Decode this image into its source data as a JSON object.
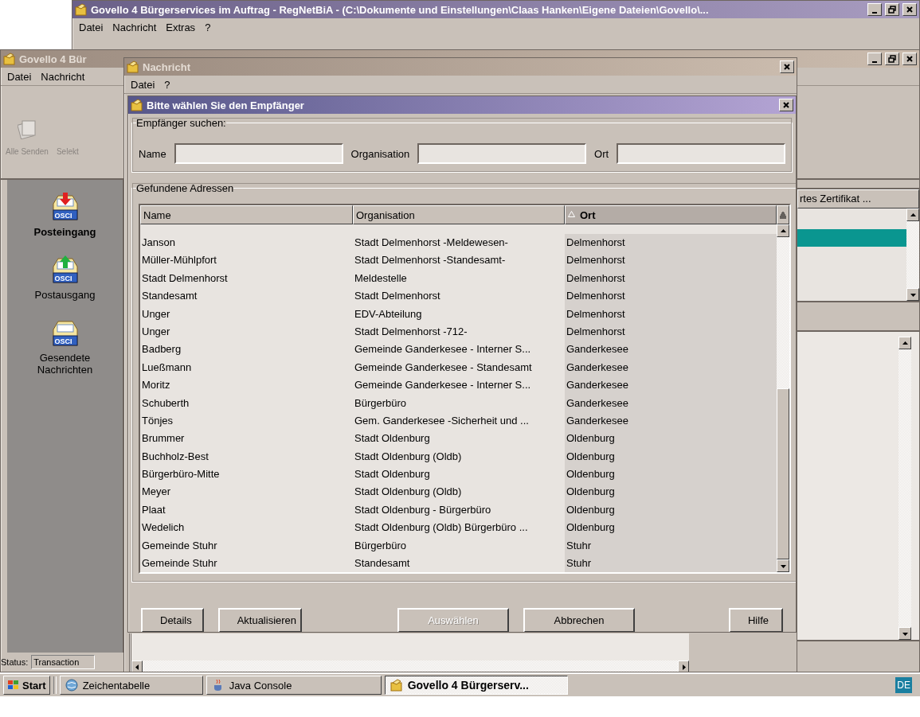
{
  "main_window": {
    "title": "Govello 4 Bürgerservices im Auftrag - RegNetBiA - (C:\\Dokumente und Einstellungen\\Claas Hanken\\Eigene Dateien\\Govello\\...",
    "menu": [
      "Datei",
      "Nachricht",
      "Extras",
      "?"
    ]
  },
  "app_window": {
    "title": "Govello 4 Bür",
    "menu": [
      "Datei",
      "Nachricht"
    ],
    "toolbar": [
      "Alle Senden",
      "Selekt"
    ],
    "folders": [
      {
        "label": "Posteingang",
        "badge": "OSCI",
        "kind": "inbox",
        "selected": true
      },
      {
        "label": "Postausgang",
        "badge": "OSCI",
        "kind": "outbox",
        "selected": false
      },
      {
        "label": "Gesendete Nachrichten",
        "badge": "OSCI",
        "kind": "sent",
        "selected": false
      }
    ],
    "list_header": "rtes Zertifikat ...",
    "list_rows": [
      {
        "selected": false
      },
      {
        "selected": true
      },
      {
        "selected": false
      }
    ],
    "status_label": "Status:",
    "status_value": "Transaction"
  },
  "message_window": {
    "title": "Nachricht",
    "menu": [
      "Datei",
      "?"
    ]
  },
  "dialog": {
    "title": "Bitte wählen Sie den Empfänger",
    "search_group": "Empfänger suchen:",
    "fields": [
      {
        "label": "Name"
      },
      {
        "label": "Organisation"
      },
      {
        "label": "Ort"
      }
    ],
    "results_group": "Gefundene Adressen",
    "columns": [
      {
        "label": "Name",
        "sorted": false
      },
      {
        "label": "Organisation",
        "sorted": false
      },
      {
        "label": "Ort",
        "sorted": true
      }
    ],
    "rows": [
      [
        "Janson",
        "Stadt Delmenhorst -Meldewesen-",
        "Delmenhorst"
      ],
      [
        "Müller-Mühlpfort",
        "Stadt Delmenhorst -Standesamt-",
        "Delmenhorst"
      ],
      [
        "Stadt Delmenhorst",
        "Meldestelle",
        "Delmenhorst"
      ],
      [
        "Standesamt",
        "Stadt Delmenhorst",
        "Delmenhorst"
      ],
      [
        "Unger",
        "EDV-Abteilung",
        "Delmenhorst"
      ],
      [
        "Unger",
        "Stadt Delmenhorst -712-",
        "Delmenhorst"
      ],
      [
        "Badberg",
        "Gemeinde Ganderkesee - Interner S...",
        "Ganderkesee"
      ],
      [
        "Lueßmann",
        "Gemeinde Ganderkesee - Standesamt",
        "Ganderkesee"
      ],
      [
        "Moritz",
        "Gemeinde Ganderkesee - Interner S...",
        "Ganderkesee"
      ],
      [
        "Schuberth",
        "Bürgerbüro",
        "Ganderkesee"
      ],
      [
        "Tönjes",
        "Gem. Ganderkesee -Sicherheit und ...",
        "Ganderkesee"
      ],
      [
        "Brummer",
        "Stadt Oldenburg",
        "Oldenburg"
      ],
      [
        "Buchholz-Best",
        "Stadt Oldenburg (Oldb)",
        "Oldenburg"
      ],
      [
        "Bürgerbüro-Mitte",
        "Stadt Oldenburg",
        "Oldenburg"
      ],
      [
        "Meyer",
        "Stadt Oldenburg (Oldb)",
        "Oldenburg"
      ],
      [
        "Plaat",
        "Stadt Oldenburg - Bürgerbüro",
        "Oldenburg"
      ],
      [
        "Wedelich",
        "Stadt Oldenburg (Oldb) Bürgerbüro ...",
        "Oldenburg"
      ],
      [
        "Gemeinde Stuhr",
        "Bürgerbüro",
        "Stuhr"
      ],
      [
        "Gemeinde Stuhr",
        "Standesamt",
        "Stuhr"
      ]
    ],
    "buttons": [
      {
        "label": "Details",
        "disabled": false
      },
      {
        "label": "Aktualisieren",
        "disabled": false
      },
      {
        "label": "Auswählen",
        "disabled": true
      },
      {
        "label": "Abbrechen",
        "disabled": false
      },
      {
        "label": "Hilfe",
        "disabled": false
      }
    ]
  },
  "taskbar": {
    "start": "Start",
    "tasks": [
      {
        "label": "Zeichentabelle",
        "kind": "charmap",
        "selected": false
      },
      {
        "label": "Java Console",
        "kind": "java",
        "selected": false
      },
      {
        "label": "Govello 4 Bürgerserv...",
        "kind": "govello",
        "selected": true
      }
    ],
    "language": "DE"
  }
}
